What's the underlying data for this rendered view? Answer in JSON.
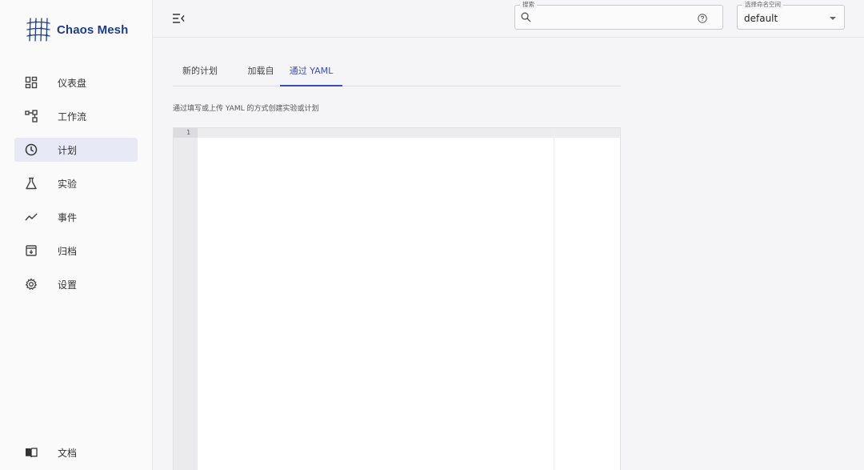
{
  "brand": {
    "name": "Chaos Mesh"
  },
  "sidebar": {
    "items": [
      {
        "label": "仪表盘",
        "icon": "dashboard-icon",
        "active": false
      },
      {
        "label": "工作流",
        "icon": "workflow-icon",
        "active": false
      },
      {
        "label": "计划",
        "icon": "clock-icon",
        "active": true
      },
      {
        "label": "实验",
        "icon": "flask-icon",
        "active": false
      },
      {
        "label": "事件",
        "icon": "trend-icon",
        "active": false
      },
      {
        "label": "归档",
        "icon": "archive-icon",
        "active": false
      },
      {
        "label": "设置",
        "icon": "gear-icon",
        "active": false
      }
    ],
    "footer": {
      "label": "文档",
      "icon": "book-icon"
    }
  },
  "header": {
    "search": {
      "legend": "搜索",
      "value": "",
      "placeholder": ""
    },
    "namespace": {
      "legend": "选择命名空间",
      "value": "default"
    }
  },
  "main": {
    "tabs": [
      {
        "label": "新的计划",
        "active": false
      },
      {
        "label": "加载自",
        "active": false
      },
      {
        "label": "通过 YAML",
        "active": true
      }
    ],
    "description": "通过填写或上传 YAML 的方式创建实验或计划",
    "editor": {
      "line_number": "1",
      "content": ""
    }
  },
  "colors": {
    "accent": "#3b4fb8",
    "brand": "#1c3d8c",
    "active_nav_bg": "#e7e9f6"
  }
}
